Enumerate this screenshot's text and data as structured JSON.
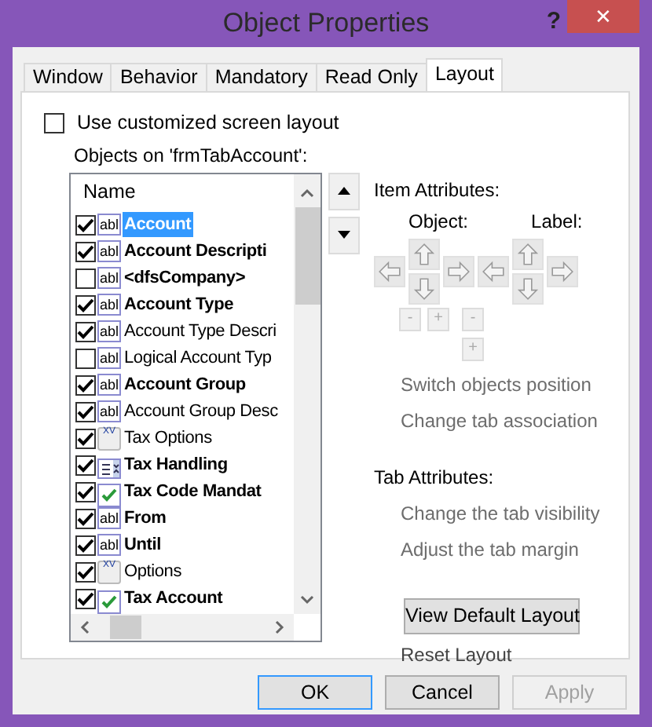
{
  "window": {
    "title": "Object Properties",
    "help": "?",
    "close": "✕"
  },
  "tabs": [
    {
      "label": "Window",
      "selected": false
    },
    {
      "label": "Behavior",
      "selected": false
    },
    {
      "label": "Mandatory",
      "selected": false
    },
    {
      "label": "Read Only",
      "selected": false
    },
    {
      "label": "Layout",
      "selected": true
    }
  ],
  "custom_layout": {
    "label": "Use customized screen layout",
    "checked": false
  },
  "objects_label": "Objects on 'frmTabAccount':",
  "list": {
    "column": "Name",
    "items": [
      {
        "label": "Account",
        "checked": true,
        "kind": "textbox",
        "icon_text": "abl",
        "bold": true,
        "selected": true
      },
      {
        "label": "Account Descripti",
        "checked": true,
        "kind": "textbox",
        "icon_text": "abl",
        "bold": true,
        "selected": false
      },
      {
        "label": "<dfsCompany>",
        "checked": false,
        "kind": "textbox",
        "icon_text": "abl",
        "bold": true,
        "selected": false
      },
      {
        "label": "Account Type",
        "checked": true,
        "kind": "textbox",
        "icon_text": "abl",
        "bold": true,
        "selected": false
      },
      {
        "label": "Account Type Descri",
        "checked": true,
        "kind": "textbox",
        "icon_text": "abl",
        "bold": false,
        "selected": false
      },
      {
        "label": "Logical Account Typ",
        "checked": false,
        "kind": "textbox",
        "icon_text": "abl",
        "bold": false,
        "selected": false
      },
      {
        "label": "Account Group",
        "checked": true,
        "kind": "textbox",
        "icon_text": "abl",
        "bold": true,
        "selected": false
      },
      {
        "label": "Account Group Desc",
        "checked": true,
        "kind": "textbox",
        "icon_text": "abl",
        "bold": false,
        "selected": false
      },
      {
        "label": "Tax Options",
        "checked": true,
        "kind": "group",
        "icon_text": "XV",
        "bold": false,
        "selected": false
      },
      {
        "label": "Tax Handling",
        "checked": true,
        "kind": "combo",
        "bold": true,
        "selected": false
      },
      {
        "label": "Tax Code Mandat",
        "checked": true,
        "kind": "checkbox",
        "bold": true,
        "selected": false
      },
      {
        "label": "From",
        "checked": true,
        "kind": "textbox",
        "icon_text": "abl",
        "bold": true,
        "selected": false
      },
      {
        "label": "Until",
        "checked": true,
        "kind": "textbox",
        "icon_text": "abl",
        "bold": true,
        "selected": false
      },
      {
        "label": "Options",
        "checked": true,
        "kind": "group",
        "icon_text": "XV",
        "bold": false,
        "selected": false
      },
      {
        "label": "Tax Account",
        "checked": true,
        "kind": "checkbox",
        "bold": true,
        "selected": false
      }
    ]
  },
  "item_attributes": {
    "title": "Item Attributes:",
    "object_label": "Object:",
    "label_label": "Label:",
    "object_size": [
      "-",
      "+"
    ],
    "label_size": [
      "-",
      "+"
    ],
    "links": [
      {
        "label": "Switch objects position",
        "disabled": true
      },
      {
        "label": "Change tab association",
        "disabled": true
      }
    ]
  },
  "tab_attributes": {
    "title": "Tab Attributes:",
    "links": [
      {
        "label": "Change the tab visibility",
        "disabled": true
      },
      {
        "label": "Adjust the tab margin",
        "disabled": true
      }
    ]
  },
  "view_default_button": "View Default Layout",
  "reset_link": {
    "label": "Reset Layout",
    "disabled": false
  },
  "buttons": [
    {
      "label": "OK",
      "default": true,
      "disabled": false
    },
    {
      "label": "Cancel",
      "default": false,
      "disabled": false
    },
    {
      "label": "Apply",
      "default": false,
      "disabled": true
    }
  ]
}
